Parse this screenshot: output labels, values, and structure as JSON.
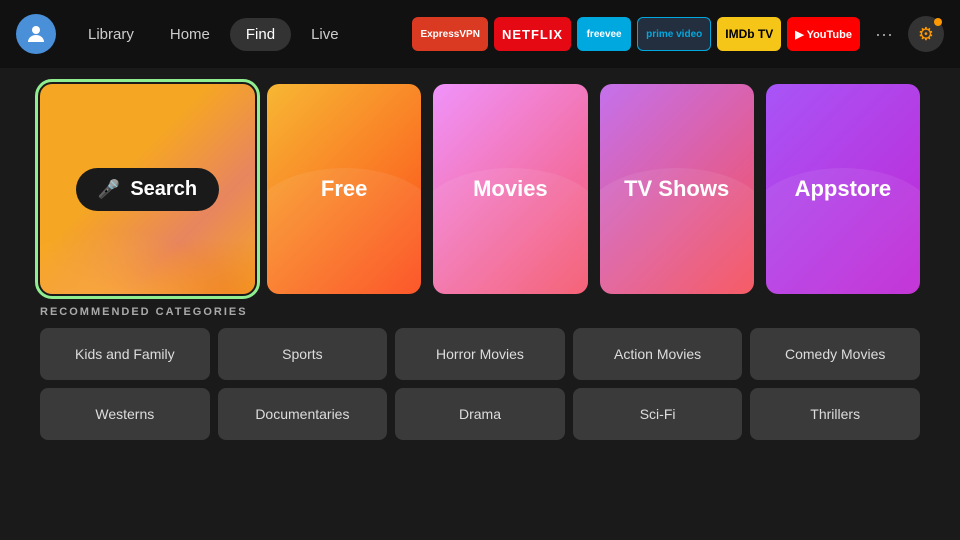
{
  "header": {
    "nav": [
      {
        "label": "Library",
        "active": false
      },
      {
        "label": "Home",
        "active": false
      },
      {
        "label": "Find",
        "active": true
      },
      {
        "label": "Live",
        "active": false
      }
    ],
    "apps": [
      {
        "id": "expressvpn",
        "label": "ExpressVPN",
        "class": "expressvpn"
      },
      {
        "id": "netflix",
        "label": "NETFLIX",
        "class": "netflix"
      },
      {
        "id": "freevee",
        "label": "freevee",
        "class": "freevee"
      },
      {
        "id": "prime",
        "label": "prime video",
        "class": "prime"
      },
      {
        "id": "imdb",
        "label": "IMDb TV",
        "class": "imdb"
      },
      {
        "id": "youtube",
        "label": "▶ YouTube",
        "class": "youtube"
      }
    ],
    "more_label": "···",
    "settings_label": "⚙"
  },
  "tiles": [
    {
      "id": "search",
      "label": "Search",
      "type": "search"
    },
    {
      "id": "free",
      "label": "Free",
      "type": "free"
    },
    {
      "id": "movies",
      "label": "Movies",
      "type": "movies"
    },
    {
      "id": "tvshows",
      "label": "TV Shows",
      "type": "tvshows"
    },
    {
      "id": "appstore",
      "label": "Appstore",
      "type": "appstore"
    }
  ],
  "categories": {
    "title": "RECOMMENDED CATEGORIES",
    "items": [
      "Kids and Family",
      "Sports",
      "Horror Movies",
      "Action Movies",
      "Comedy Movies",
      "Westerns",
      "Documentaries",
      "Drama",
      "Sci-Fi",
      "Thrillers"
    ]
  },
  "mic_symbol": "🎤"
}
